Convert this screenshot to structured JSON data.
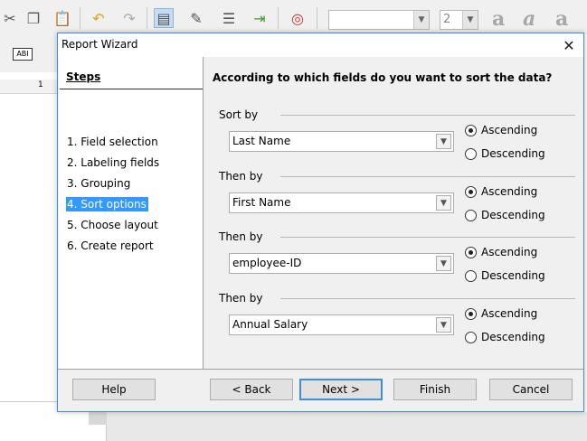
{
  "toolbar": {
    "font_size": "2",
    "icons": [
      "cut-icon",
      "copy-icon",
      "paste-icon",
      "undo-icon",
      "redo-icon",
      "table-icon",
      "edit-icon",
      "form-icon",
      "import-icon",
      "help-lifebuoy-icon",
      "bold-a-icon",
      "italic-a-icon",
      "align-icon"
    ]
  },
  "ruler": {
    "mark": "1"
  },
  "sidebar_button": "ABI",
  "dialog": {
    "title": "Report Wizard",
    "steps_heading": "Steps",
    "steps": [
      "1. Field selection",
      "2. Labeling fields",
      "3. Grouping",
      "4. Sort options",
      "5. Choose layout",
      "6. Create report"
    ],
    "active_step": 3,
    "question": "According to which fields do you want to sort the data?",
    "groups": [
      {
        "label": "Sort by",
        "field": "Last Name",
        "ascending": "Ascending",
        "descending": "Descending",
        "selected": "Ascending"
      },
      {
        "label": "Then by",
        "field": "First Name",
        "ascending": "Ascending",
        "descending": "Descending",
        "selected": "Ascending"
      },
      {
        "label": "Then by",
        "field": "employee-ID",
        "ascending": "Ascending",
        "descending": "Descending",
        "selected": "Ascending"
      },
      {
        "label": "Then by",
        "field": "Annual Salary",
        "ascending": "Ascending",
        "descending": "Descending",
        "selected": "Ascending"
      }
    ],
    "buttons": {
      "help": "Help",
      "back": "< Back",
      "next": "Next >",
      "finish": "Finish",
      "cancel": "Cancel"
    }
  },
  "colors": {
    "accent": "#3399ff",
    "dialog_border": "#3d8de0"
  }
}
